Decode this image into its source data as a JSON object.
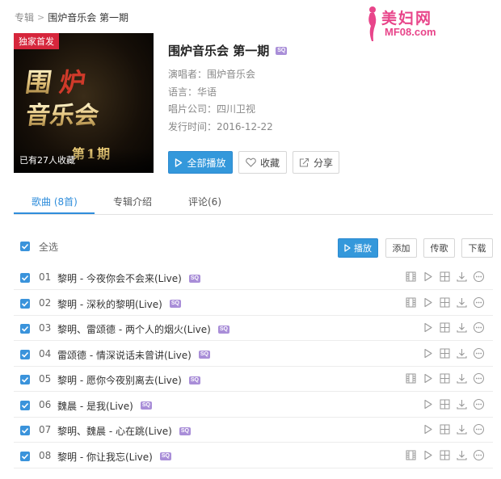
{
  "breadcrumb": {
    "parent": "专辑",
    "separator": ">",
    "current": "围炉音乐会 第一期"
  },
  "watermark": {
    "text": "美妇网",
    "url": "MF08.com"
  },
  "cover": {
    "badge": "独家首发",
    "logo_text": "围炉音乐会",
    "period": "第1期",
    "collect_count": "已有27人收藏"
  },
  "album": {
    "title": "围炉音乐会 第一期",
    "quality_badge": "SQ",
    "singer_label": "演唱者：",
    "singer": "围炉音乐会",
    "language_label": "语言：",
    "language": "华语",
    "company_label": "唱片公司：",
    "company": "四川卫视",
    "release_label": "发行时间：",
    "release_date": "2016-12-22"
  },
  "actions": {
    "play_all": "全部播放",
    "favorite": "收藏",
    "share": "分享"
  },
  "tabs": [
    {
      "label": "歌曲 (8首)",
      "active": true
    },
    {
      "label": "专辑介绍",
      "active": false
    },
    {
      "label": "评论(6)",
      "active": false
    }
  ],
  "toolbar": {
    "select_all": "全选",
    "play": "播放",
    "add": "添加",
    "send": "传歌",
    "download": "下载"
  },
  "songs": [
    {
      "num": "01",
      "title": "黎明 - 今夜你会不会来(Live)",
      "badge": "SQ",
      "has_mv": true
    },
    {
      "num": "02",
      "title": "黎明 - 深秋的黎明(Live)",
      "badge": "SQ",
      "has_mv": true
    },
    {
      "num": "03",
      "title": "黎明、雷颂德 - 两个人的烟火(Live)",
      "badge": "SQ",
      "has_mv": false
    },
    {
      "num": "04",
      "title": "雷颂德 - 情深说话未曾讲(Live)",
      "badge": "SQ",
      "has_mv": false
    },
    {
      "num": "05",
      "title": "黎明 - 愿你今夜别离去(Live)",
      "badge": "SQ",
      "has_mv": true
    },
    {
      "num": "06",
      "title": "魏晨 - 是我(Live)",
      "badge": "SQ",
      "has_mv": false
    },
    {
      "num": "07",
      "title": "黎明、魏晨 - 心在跳(Live)",
      "badge": "SQ",
      "has_mv": false
    },
    {
      "num": "08",
      "title": "黎明 - 你让我忘(Live)",
      "badge": "SQ",
      "has_mv": true
    }
  ],
  "colors": {
    "accent": "#3498db",
    "tab_active": "#2f8ddb",
    "badge_red": "#d6263c",
    "sq_badge": "#a98ed8",
    "watermark": "#e8458a"
  }
}
